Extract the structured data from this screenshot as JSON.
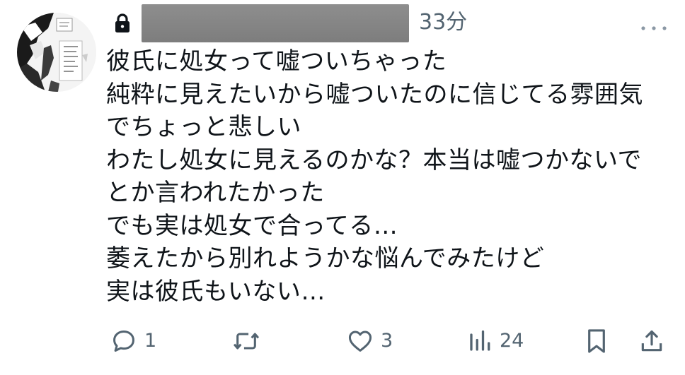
{
  "post": {
    "timestamp": "33分",
    "lines": [
      "彼氏に処女って嘘ついちゃった",
      "純粋に見えたいから嘘ついたのに信じてる雰囲気",
      "でちょっと悲しい",
      "わたし処女に見えるのかな？本当は嘘つかないで",
      "とか言われたかった",
      "でも実は処女で合ってる…",
      "萎えたから別れようかな悩んでみたけど",
      "実は彼氏もいない…"
    ]
  },
  "actions": {
    "reply_count": "1",
    "repost_count": "",
    "like_count": "3",
    "view_count": "24"
  },
  "icons": {
    "account": "lock-icon",
    "more": "more-icon",
    "reply": "reply-icon",
    "repost": "repost-icon",
    "like": "heart-icon",
    "views": "views-icon",
    "bookmark": "bookmark-icon",
    "share": "share-icon"
  },
  "colors": {
    "text": "#0f1419",
    "secondary": "#536471",
    "redaction": "#858585"
  }
}
